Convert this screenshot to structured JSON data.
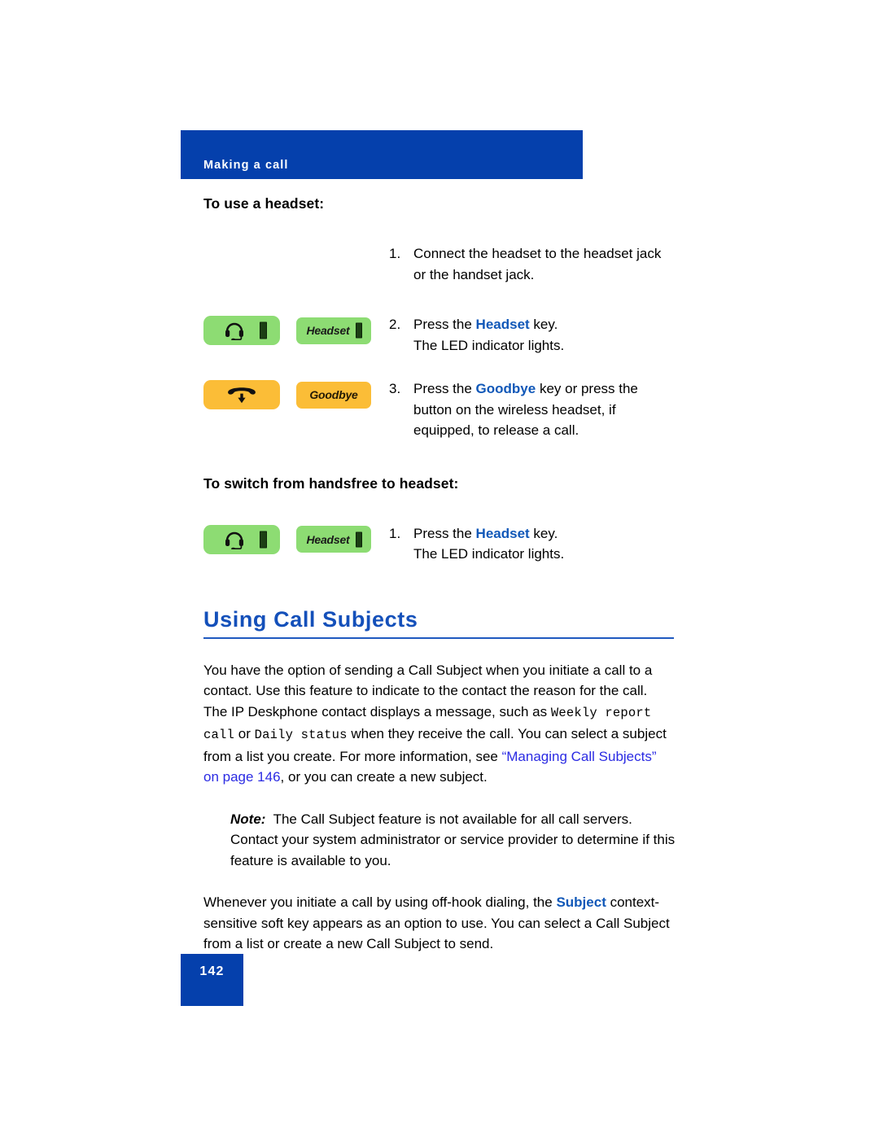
{
  "header": {
    "running_title": "Making a call"
  },
  "procedures": [
    {
      "heading": "To use a headset:",
      "steps": [
        {
          "number": "1.",
          "keys": [],
          "lines": [
            {
              "segments": [
                {
                  "text": "Connect the headset to the headset jack",
                  "style": "plain"
                }
              ]
            },
            {
              "segments": [
                {
                  "text": "or the handset jack.",
                  "style": "plain"
                }
              ]
            }
          ]
        },
        {
          "number": "2.",
          "keys": [
            {
              "type": "icon",
              "icon": "headset-icon",
              "color": "green",
              "led": true
            },
            {
              "type": "label",
              "label": "Headset",
              "color": "green",
              "led": true
            }
          ],
          "lines": [
            {
              "segments": [
                {
                  "text": "Press the ",
                  "style": "plain"
                },
                {
                  "text": "Headset",
                  "style": "keyword"
                },
                {
                  "text": " key.",
                  "style": "plain"
                }
              ]
            },
            {
              "segments": [
                {
                  "text": "The LED indicator lights.",
                  "style": "plain"
                }
              ]
            }
          ]
        },
        {
          "number": "3.",
          "keys": [
            {
              "type": "icon",
              "icon": "goodbye-handset-down-icon",
              "color": "amber",
              "led": false
            },
            {
              "type": "label",
              "label": "Goodbye",
              "color": "amber",
              "led": false
            }
          ],
          "lines": [
            {
              "segments": [
                {
                  "text": "Press the ",
                  "style": "plain"
                },
                {
                  "text": "Goodbye",
                  "style": "keyword"
                },
                {
                  "text": " key or press the",
                  "style": "plain"
                }
              ]
            },
            {
              "segments": [
                {
                  "text": "button on the wireless headset, if",
                  "style": "plain"
                }
              ]
            },
            {
              "segments": [
                {
                  "text": "equipped, to release a call.",
                  "style": "plain"
                }
              ]
            }
          ]
        }
      ]
    },
    {
      "heading": "To switch from handsfree to headset:",
      "steps": [
        {
          "number": "1.",
          "keys": [
            {
              "type": "icon",
              "icon": "headset-icon",
              "color": "green",
              "led": true
            },
            {
              "type": "label",
              "label": "Headset",
              "color": "green",
              "led": true
            }
          ],
          "lines": [
            {
              "segments": [
                {
                  "text": "Press the ",
                  "style": "plain"
                },
                {
                  "text": "Headset",
                  "style": "keyword"
                },
                {
                  "text": " key.",
                  "style": "plain"
                }
              ]
            },
            {
              "segments": [
                {
                  "text": "The LED indicator lights.",
                  "style": "plain"
                }
              ]
            }
          ]
        }
      ]
    }
  ],
  "section": {
    "heading": "Using Call Subjects",
    "intro_parts": {
      "p1a": "You have the option of sending a Call Subject when you initiate a call to a contact. Use this feature to indicate to the contact the reason for the call. The IP Deskphone contact displays a message, such as ",
      "mono1": "Weekly report call",
      "mid1": " or ",
      "mono2": "Daily status",
      "p1b": " when they receive the call. You can select a subject from a list you create. For more information, see ",
      "xref": "“Managing Call Subjects” on page 146",
      "p1c": ", or you can create a new subject."
    },
    "note": {
      "label": "Note:",
      "text": "The Call Subject feature is not available for all call servers. Contact your system administrator or service provider to determine if this feature is available to you."
    },
    "closing": {
      "part_a": "Whenever you initiate a call by using off-hook dialing, the ",
      "keyword": "Subject",
      "part_b": " context-sensitive soft key appears as an option to use. You can select a Call Subject from a list or create a new Call Subject to send."
    }
  },
  "footer": {
    "page_number": "142"
  },
  "colors": {
    "brand_blue": "#0540ac",
    "heading_blue": "#1450ba",
    "keyword_blue": "#1158b8",
    "xref_blue": "#2b2be3",
    "key_green": "#8ddc73",
    "key_amber": "#fbbd37"
  }
}
